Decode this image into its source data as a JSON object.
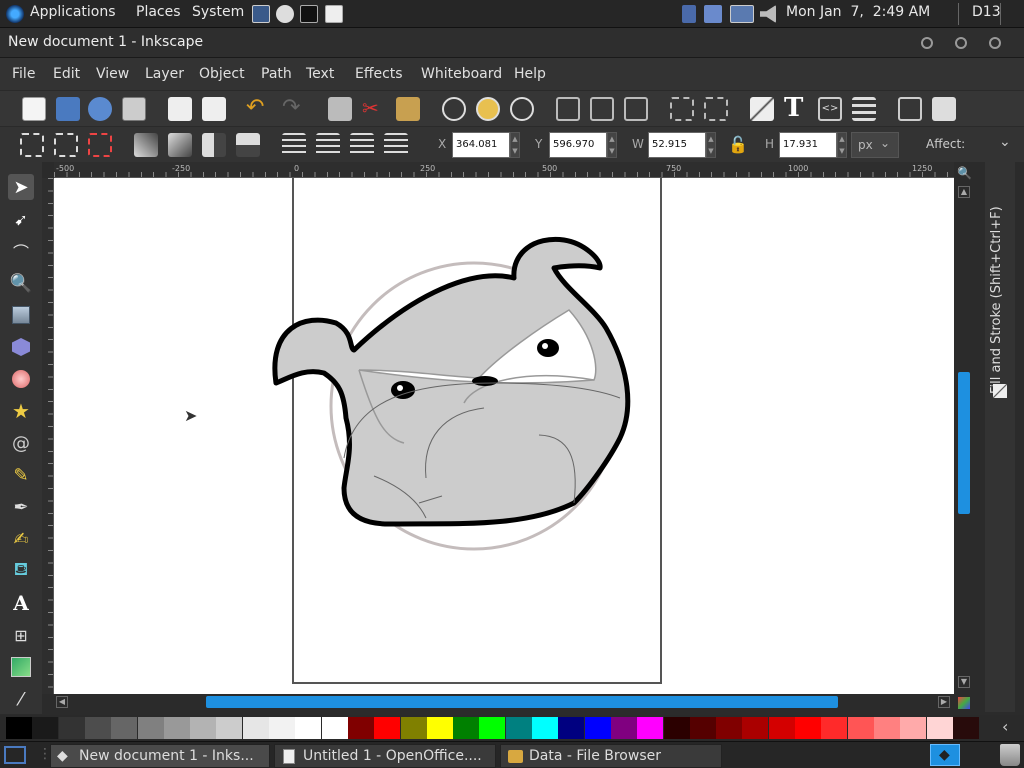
{
  "top_panel": {
    "menus": [
      "Applications",
      "Places",
      "System"
    ],
    "clock": "Mon Jan  7,  2:49 AM",
    "workspace": "D13"
  },
  "window": {
    "title": "New document 1 - Inkscape"
  },
  "menubar": {
    "items": [
      "File",
      "Edit",
      "View",
      "Layer",
      "Object",
      "Path",
      "Text",
      "Effects",
      "Whiteboard",
      "Help"
    ]
  },
  "controls": {
    "x_label": "X",
    "x_value": "364.081",
    "y_label": "Y",
    "y_value": "596.970",
    "w_label": "W",
    "w_value": "52.915",
    "h_label": "H",
    "h_value": "17.931",
    "unit": "px",
    "affect_label": "Affect:"
  },
  "rulers": {
    "h_ticks": [
      "-500",
      "-250",
      "0",
      "250",
      "500",
      "750",
      "1000",
      "1250"
    ]
  },
  "dock": {
    "panel_title": "Fill and Stroke (Shift+Ctrl+F)"
  },
  "palette": {
    "colors": [
      "#000000",
      "#1a1a1a",
      "#333333",
      "#4d4d4d",
      "#666666",
      "#808080",
      "#999999",
      "#b3b3b3",
      "#cccccc",
      "#e6e6e6",
      "#f2f2f2",
      "#ffffff",
      "#ffffff",
      "#800000",
      "#ff0000",
      "#808000",
      "#ffff00",
      "#008000",
      "#00ff00",
      "#008080",
      "#00ffff",
      "#000080",
      "#0000ff",
      "#800080",
      "#ff00ff",
      "#2b0000",
      "#550000",
      "#800000",
      "#aa0000",
      "#d40000",
      "#ff0000",
      "#ff2a2a",
      "#ff5555",
      "#ff8080",
      "#ffaaaa",
      "#ffd5d5",
      "#280b0b"
    ]
  },
  "taskbar": {
    "tasks": [
      "New document 1 - Inks...",
      "Untitled 1 - OpenOffice....",
      "Data - File Browser"
    ]
  },
  "colors": {
    "accent": "#1e90e0",
    "panel_bg": "#262626"
  }
}
